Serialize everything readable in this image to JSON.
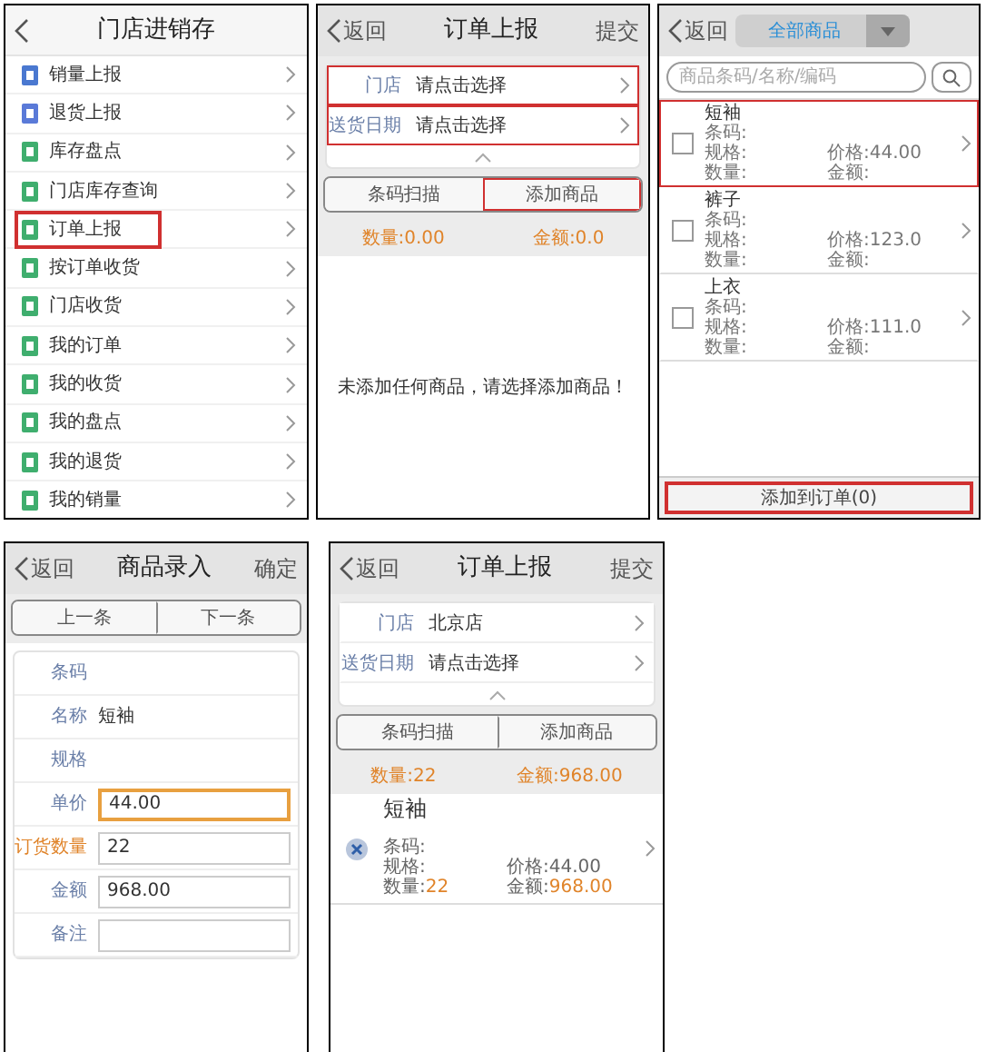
{
  "screens": [
    {
      "kind": "menu",
      "title": "门店进销存",
      "items": [
        {
          "label": "销量上报",
          "color": "#4a78d0",
          "highlighted": false
        },
        {
          "label": "退货上报",
          "color": "#5a7ad8",
          "highlighted": false
        },
        {
          "label": "库存盘点",
          "color": "#3fae6e",
          "highlighted": false
        },
        {
          "label": "门店库存查询",
          "color": "#3fae6e",
          "highlighted": false
        },
        {
          "label": "订单上报",
          "color": "#3fae6e",
          "highlighted": true
        },
        {
          "label": "按订单收货",
          "color": "#3fae6e",
          "highlighted": false
        },
        {
          "label": "门店收货",
          "color": "#3fae6e",
          "highlighted": false
        },
        {
          "label": "我的订单",
          "color": "#3fae6e",
          "highlighted": false
        },
        {
          "label": "我的收货",
          "color": "#3fae6e",
          "highlighted": false
        },
        {
          "label": "我的盘点",
          "color": "#3fae6e",
          "highlighted": false
        },
        {
          "label": "我的退货",
          "color": "#3fae6e",
          "highlighted": false
        },
        {
          "label": "我的销量",
          "color": "#3fae6e",
          "highlighted": false
        }
      ]
    },
    {
      "kind": "order",
      "back": "返回",
      "title": "订单上报",
      "action": "提交",
      "fields": [
        {
          "label": "门店",
          "value": "请点击选择",
          "highlighted": true
        },
        {
          "label": "送货日期",
          "value": "请点击选择",
          "highlighted": true
        }
      ],
      "buttons": [
        {
          "label": "条码扫描",
          "highlighted": false
        },
        {
          "label": "添加商品",
          "highlighted": true
        }
      ],
      "summary": {
        "quantity": "数量:0.00",
        "amount": "金额:0.0"
      },
      "empty_message": "未添加任何商品，请选择添加商品！"
    },
    {
      "kind": "picker",
      "back": "返回",
      "category": "全部商品",
      "search": {
        "placeholder": "商品条码/名称/编码"
      },
      "products": [
        {
          "name": "短袖",
          "barcode": "条码:",
          "spec": "规格:",
          "price": "价格:44.00",
          "quantity": "数量:",
          "amount": "金额:",
          "checked": false,
          "highlighted": true
        },
        {
          "name": "裤子",
          "barcode": "条码:",
          "spec": "规格:",
          "price": "价格:123.0",
          "quantity": "数量:",
          "amount": "金额:",
          "checked": false,
          "highlighted": false
        },
        {
          "name": "上衣",
          "barcode": "条码:",
          "spec": "规格:",
          "price": "价格:111.0",
          "quantity": "数量:",
          "amount": "金额:",
          "checked": false,
          "highlighted": false
        }
      ],
      "submit": {
        "label": "添加到订单(0)",
        "highlighted": true
      }
    },
    {
      "kind": "entry",
      "back": "返回",
      "title": "商品录入",
      "action": "确定",
      "pager": [
        "上一条",
        "下一条"
      ],
      "fields": [
        {
          "label": "条码",
          "kind": "text",
          "emphasized": false
        },
        {
          "label": "名称",
          "kind": "text",
          "value": "短袖",
          "emphasized": false
        },
        {
          "label": "规格",
          "kind": "text",
          "emphasized": false
        },
        {
          "label": "单价",
          "kind": "input",
          "value": "44.00",
          "focused": true,
          "emphasized": false
        },
        {
          "label": "订货数量",
          "kind": "input",
          "value": "22",
          "focused": false,
          "emphasized": true
        },
        {
          "label": "金额",
          "kind": "input",
          "value": "968.00",
          "focused": false,
          "emphasized": false
        },
        {
          "label": "备注",
          "kind": "input",
          "focused": false,
          "emphasized": false
        }
      ]
    },
    {
      "kind": "order",
      "back": "返回",
      "title": "订单上报",
      "action": "提交",
      "fields": [
        {
          "label": "门店",
          "value": "北京店",
          "highlighted": false
        },
        {
          "label": "送货日期",
          "value": "请点击选择",
          "highlighted": false
        }
      ],
      "buttons": [
        {
          "label": "条码扫描",
          "highlighted": false
        },
        {
          "label": "添加商品",
          "highlighted": false
        }
      ],
      "summary": {
        "quantity": "数量:22",
        "amount": "金额:968.00"
      },
      "lines": [
        {
          "name": "短袖",
          "barcode": "条码:",
          "spec": "规格:",
          "price": "价格:44.00",
          "quantity_label": "数量:",
          "quantity": "22",
          "amount_label": "金额:",
          "amount": "968.00"
        }
      ]
    }
  ]
}
